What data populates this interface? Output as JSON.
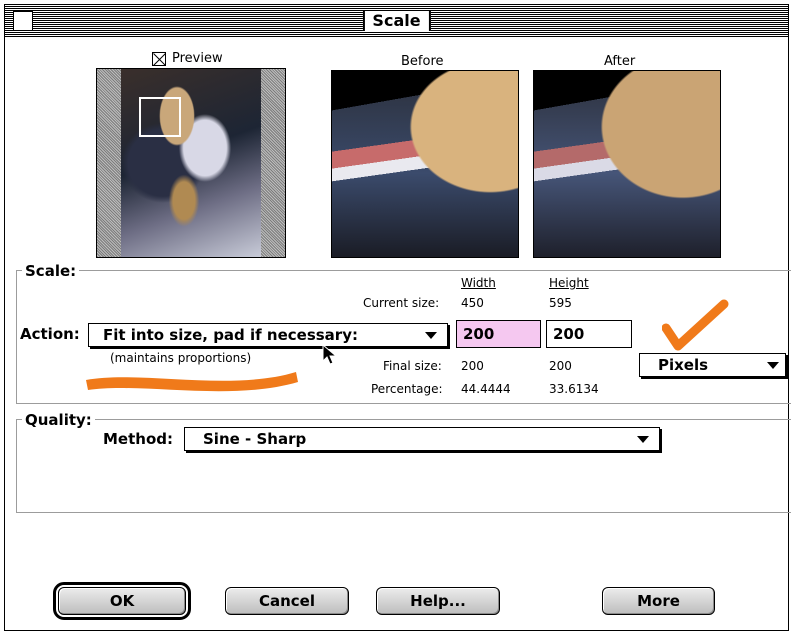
{
  "window": {
    "title": "Scale"
  },
  "preview": {
    "checkbox_label": "Preview",
    "checked": true
  },
  "before_label": "Before",
  "after_label": "After",
  "scale_group": {
    "title": "Scale:",
    "width_header": "Width",
    "height_header": "Height",
    "current_size_label": "Current size:",
    "current_width": "450",
    "current_height": "595",
    "action_label": "Action:",
    "action_value": "Fit into size, pad if necessary:",
    "action_note": "(maintains proportions)",
    "width_value": "200",
    "height_value": "200",
    "units_value": "Pixels",
    "final_size_label": "Final size:",
    "final_width": "200",
    "final_height": "200",
    "percentage_label": "Percentage:",
    "percentage_width": "44.4444",
    "percentage_height": "33.6134"
  },
  "quality_group": {
    "title": "Quality:",
    "method_label": "Method:",
    "method_value": "Sine - Sharp"
  },
  "buttons": {
    "ok": "OK",
    "cancel": "Cancel",
    "help": "Help...",
    "more": "More"
  },
  "colors": {
    "annotation": "#f07a1a",
    "width_field_bg": "#f5c8f0"
  }
}
